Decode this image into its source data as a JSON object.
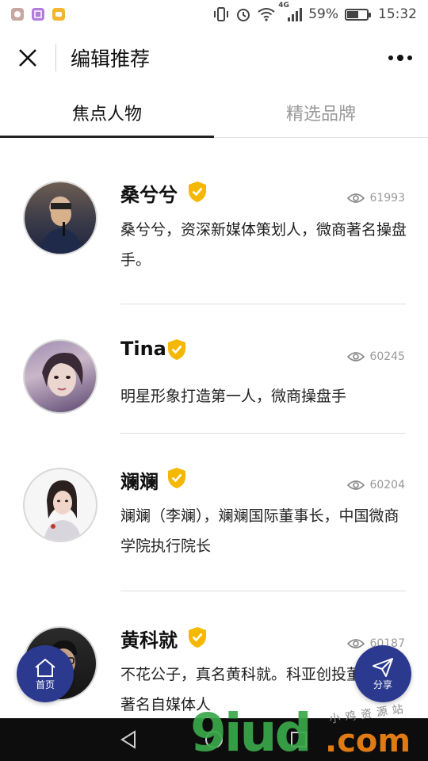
{
  "status_bar": {
    "network": "4G",
    "battery_percent": "59%",
    "battery_level": 0.59,
    "time": "15:32"
  },
  "header": {
    "title": "编辑推荐"
  },
  "tabs": [
    {
      "label": "焦点人物",
      "active": true
    },
    {
      "label": "精选品牌",
      "active": false
    }
  ],
  "items": [
    {
      "name": "桑兮兮",
      "views": "61993",
      "description": "桑兮兮，资深新媒体策划人，微商著名操盘手。",
      "verified": true
    },
    {
      "name": "Tina",
      "views": "60245",
      "description": "明星形象打造第一人，微商操盘手",
      "verified": true
    },
    {
      "name": "斓斓",
      "views": "60204",
      "description": "斓斓（李斓），斓斓国际董事长，中国微商学院执行院长",
      "verified": true
    },
    {
      "name": "黄科就",
      "views": "60187",
      "description": "不花公子，真名黄科就。科亚创投董事长，著名自媒体人",
      "verified": true
    }
  ],
  "fab": {
    "home_label": "首页",
    "share_label": "分享"
  },
  "watermark": {
    "brand": "9iud",
    "domain": ".com",
    "small_text": "小鸡资源站"
  },
  "colors": {
    "accent": "#2b3a8f",
    "verified": "#f5b800",
    "nav_bar": "#0d0d0d"
  }
}
